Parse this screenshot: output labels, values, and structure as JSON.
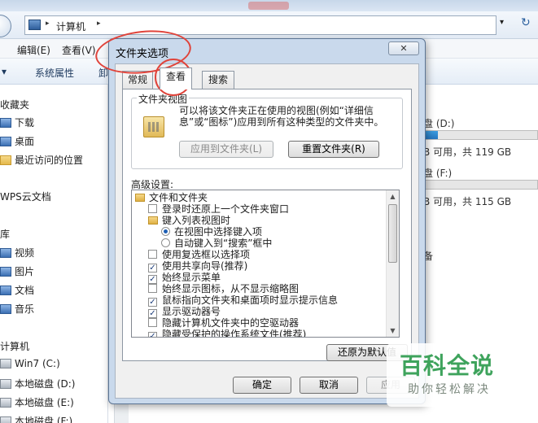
{
  "explorer": {
    "address": {
      "path": "计算机"
    },
    "menu": [
      "编辑(E)",
      "查看(V)"
    ],
    "toolbar": {
      "system_props": "系统属性",
      "partial": "卸"
    },
    "nav": {
      "favorites": "收藏夹",
      "downloads": "下载",
      "desktop": "桌面",
      "recent": "最近访问的位置",
      "wps": "WPS云文档",
      "libraries": "库",
      "videos": "视频",
      "pictures": "图片",
      "documents": "文档",
      "music": "音乐",
      "computer": "计算机",
      "drive_c": "Win7 (C:)",
      "drive_d": "本地磁盘 (D:)",
      "drive_e": "本地磁盘 (E:)",
      "drive_f": "本地磁盘 (F:)"
    },
    "content": {
      "drive_d_label": "盘 (D:)",
      "drive_d_free": "B 可用，共 119 GB",
      "drive_d_usage": 0.12,
      "drive_f_label": "盘 (F:)",
      "drive_f_free": "B 可用，共 115 GB",
      "drive_f_usage": 0.0,
      "other": "备"
    }
  },
  "dialog": {
    "title": "文件夹选项",
    "close_glyph": "✕",
    "tabs": [
      "常规",
      "查看",
      "搜索"
    ],
    "active_tab": "查看",
    "folder_views": {
      "legend": "文件夹视图",
      "description": "可以将该文件夹正在使用的视图(例如“详细信息”或“图标”)应用到所有这种类型的文件夹中。",
      "apply_button": "应用到文件夹(L)",
      "reset_button": "重置文件夹(R)"
    },
    "advanced_label": "高级设置:",
    "tree_items": [
      {
        "kind": "folder",
        "indent": 0,
        "label": "文件和文件夹"
      },
      {
        "kind": "check",
        "checked": false,
        "indent": 1,
        "label": "登录时还原上一个文件夹窗口"
      },
      {
        "kind": "folder",
        "indent": 1,
        "label": "键入列表视图时"
      },
      {
        "kind": "radio",
        "checked": true,
        "indent": 2,
        "label": "在视图中选择键入项"
      },
      {
        "kind": "radio",
        "checked": false,
        "indent": 2,
        "label": "自动键入到“搜索”框中"
      },
      {
        "kind": "check",
        "checked": false,
        "indent": 1,
        "label": "使用复选框以选择项"
      },
      {
        "kind": "check",
        "checked": true,
        "indent": 1,
        "label": "使用共享向导(推荐)"
      },
      {
        "kind": "check",
        "checked": true,
        "indent": 1,
        "label": "始终显示菜单"
      },
      {
        "kind": "check",
        "checked": false,
        "indent": 1,
        "label": "始终显示图标，从不显示缩略图"
      },
      {
        "kind": "check",
        "checked": true,
        "indent": 1,
        "label": "鼠标指向文件夹和桌面项时显示提示信息"
      },
      {
        "kind": "check",
        "checked": true,
        "indent": 1,
        "label": "显示驱动器号"
      },
      {
        "kind": "check",
        "checked": false,
        "indent": 1,
        "label": "隐藏计算机文件夹中的空驱动器"
      },
      {
        "kind": "check",
        "checked": true,
        "indent": 1,
        "label": "隐藏受保护的操作系统文件(推荐)"
      }
    ],
    "restore_button": "还原为默认值",
    "ok_button": "确定",
    "cancel_button": "取消",
    "apply_button": "应用"
  },
  "watermark": {
    "main": "百科全说",
    "sub": "助你轻松解决"
  },
  "colors": {
    "annotation": "#e0433a",
    "watermark": "#3ea35c"
  }
}
